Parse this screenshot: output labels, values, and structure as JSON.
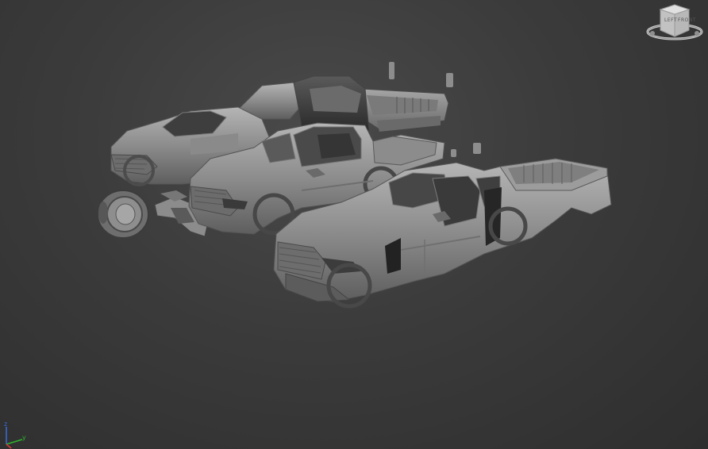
{
  "viewport": {
    "type": "3d-perspective-view",
    "background_color": "#3a3a3a"
  },
  "viewcube": {
    "face_labels": [
      "LEFT",
      "FRONT"
    ],
    "icon": "viewcube-icon"
  },
  "axis_tripod": {
    "icon": "axis-tripod-icon",
    "axes": [
      "z",
      "y",
      "x"
    ]
  },
  "scene": {
    "objects": [
      "pickup-truck-exploded-parts",
      "pickup-truck-extended-cab",
      "pickup-truck-double-cab"
    ]
  }
}
